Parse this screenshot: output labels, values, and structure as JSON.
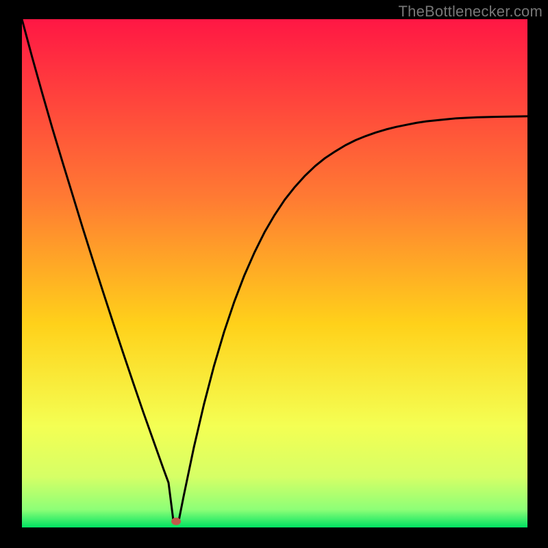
{
  "watermark": "TheBottleneсker.com",
  "chart_data": {
    "type": "line",
    "title": "",
    "xlabel": "",
    "ylabel": "",
    "xlim": [
      0,
      100
    ],
    "ylim": [
      0,
      100
    ],
    "curve_note": "V-shaped bottleneck curve touching ~0 near x≈30, rising steeply toward both ends",
    "x": [
      0,
      2,
      4,
      6,
      8,
      10,
      12,
      14,
      16,
      18,
      20,
      22,
      24,
      26,
      27,
      28,
      29,
      30,
      31,
      32,
      34,
      36,
      38,
      40,
      42,
      44,
      46,
      48,
      50,
      52,
      54,
      56,
      58,
      60,
      62,
      64,
      66,
      68,
      70,
      72,
      74,
      76,
      78,
      80,
      82,
      84,
      86,
      88,
      90,
      92,
      94,
      96,
      98,
      100
    ],
    "y": [
      100,
      92.6,
      85.5,
      78.6,
      72.0,
      65.5,
      59.0,
      52.7,
      46.5,
      40.4,
      34.4,
      28.5,
      22.7,
      17.1,
      14.3,
      11.5,
      8.8,
      1.0,
      1.2,
      6.2,
      15.7,
      24.2,
      31.8,
      38.5,
      44.4,
      49.6,
      54.1,
      58.1,
      61.5,
      64.5,
      67.0,
      69.2,
      71.1,
      72.7,
      74.0,
      75.2,
      76.2,
      77.0,
      77.7,
      78.3,
      78.8,
      79.2,
      79.6,
      79.9,
      80.1,
      80.3,
      80.5,
      80.6,
      80.7,
      80.75,
      80.8,
      80.83,
      80.86,
      80.9
    ],
    "marker": {
      "x": 30.5,
      "y": 1.2,
      "color": "#c05a4a"
    },
    "gradient_stops": [
      {
        "offset": 0.0,
        "color": "#ff1744"
      },
      {
        "offset": 0.35,
        "color": "#ff7a33"
      },
      {
        "offset": 0.6,
        "color": "#ffd11a"
      },
      {
        "offset": 0.8,
        "color": "#f4ff53"
      },
      {
        "offset": 0.9,
        "color": "#d6ff66"
      },
      {
        "offset": 0.965,
        "color": "#8dff77"
      },
      {
        "offset": 1.0,
        "color": "#00e262"
      }
    ],
    "frame": {
      "inset_left": 32,
      "inset_top": 28,
      "inset_right": 30,
      "inset_bottom": 30,
      "stroke": "#000000"
    }
  }
}
